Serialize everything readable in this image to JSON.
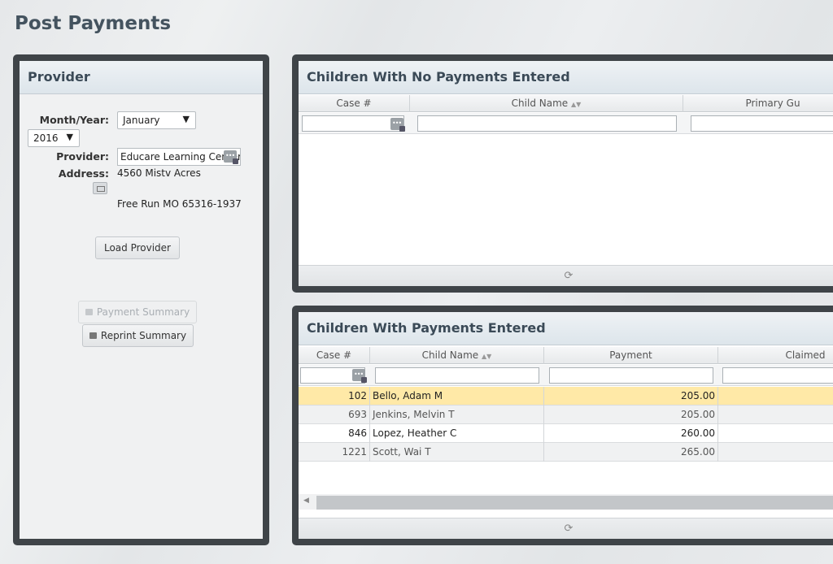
{
  "page": {
    "title": "Post Payments"
  },
  "provider": {
    "header": "Provider",
    "month_year_label": "Month/Year:",
    "month_value": "January",
    "year_value": "2016",
    "provider_label": "Provider:",
    "provider_value": "Educare Learning Center",
    "address_label": "Address:",
    "address_line1": "4560 Mistv Acres",
    "address_line2": "Free Run MO 65316-1937",
    "load_button": "Load Provider",
    "payment_summary_button": "Payment Summary",
    "reprint_summary_button": "Reprint Summary"
  },
  "no_payments": {
    "header": "Children With No Payments Entered",
    "columns": [
      "Case #",
      "Child Name",
      "Primary Gu"
    ],
    "footer_icon": "refresh-icon"
  },
  "payments": {
    "header": "Children With Payments Entered",
    "columns": [
      "Case #",
      "Child Name",
      "Payment",
      "Claimed"
    ],
    "rows": [
      {
        "case": "102",
        "name": "Bello, Adam M",
        "payment": "205.00",
        "claimed": ""
      },
      {
        "case": "693",
        "name": "Jenkins, Melvin T",
        "payment": "205.00",
        "claimed": ""
      },
      {
        "case": "846",
        "name": "Lopez, Heather C",
        "payment": "260.00",
        "claimed": ""
      },
      {
        "case": "1221",
        "name": "Scott, Wai T",
        "payment": "265.00",
        "claimed": ""
      }
    ],
    "footer_icon": "refresh-icon"
  },
  "icons": {
    "sort": "sort-icon",
    "lookup": "lookup-icon",
    "lock": "lock-icon",
    "address": "address-icon"
  }
}
